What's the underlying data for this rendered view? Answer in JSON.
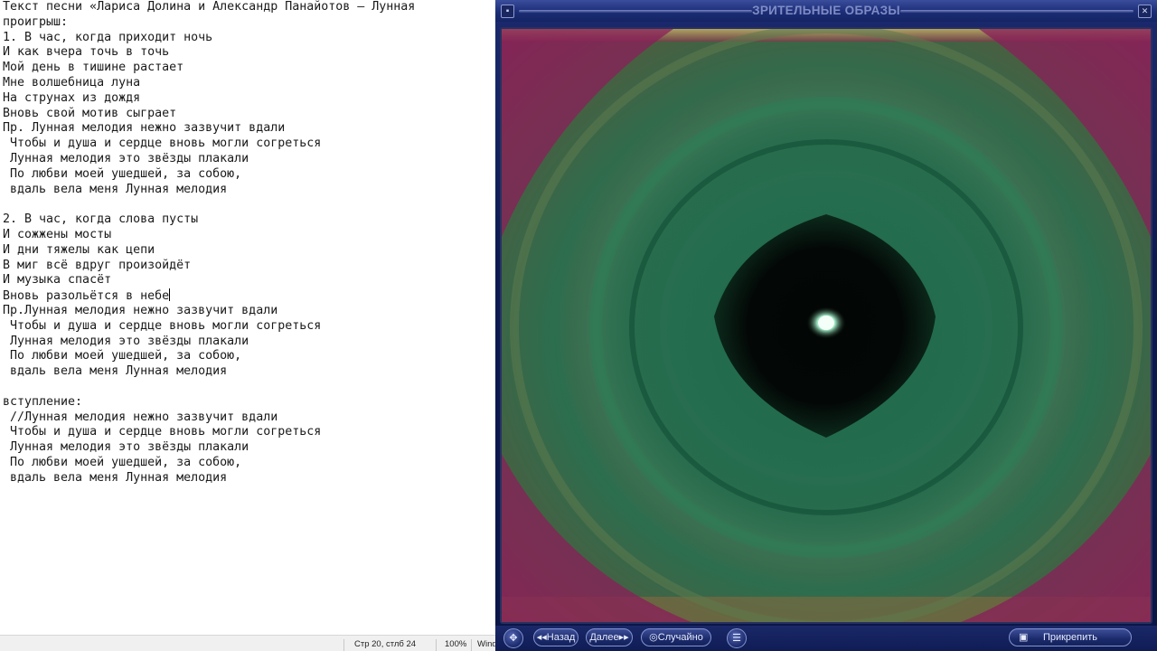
{
  "notepad": {
    "lines": [
      "Текст песни «Лариса Долина и Александр Панайотов – Лунная",
      "проигрыш:",
      "1. В час, когда приходит ночь",
      "И как вчера точь в точь",
      "Мой день в тишине растает",
      "Мне волшебница луна",
      "На струнах из дождя",
      "Вновь свой мотив сыграет",
      "Пр. Лунная мелодия нежно зазвучит вдали",
      " Чтобы и душа и сердце вновь могли согреться",
      " Лунная мелодия это звёзды плакали",
      " По любви моей ушедшей, за собою,",
      " вдаль вела меня Лунная мелодия",
      "",
      "2. В час, когда слова пусты",
      "И сожжены мосты",
      "И дни тяжелы как цепи",
      "В миг всё вдруг произойдёт",
      "И музыка спасёт",
      "Вновь разольётся в небе",
      "Пр.Лунная мелодия нежно зазвучит вдали",
      " Чтобы и душа и сердце вновь могли согреться",
      " Лунная мелодия это звёзды плакали",
      " По любви моей ушедшей, за собою,",
      " вдаль вела меня Лунная мелодия",
      "",
      "вступление:",
      " //Лунная мелодия нежно зазвучит вдали",
      " Чтобы и душа и сердце вновь могли согреться",
      " Лунная мелодия это звёзды плакали",
      " По любви моей ушедшей, за собою,",
      " вдаль вела меня Лунная мелодия"
    ],
    "caret_line_index": 19,
    "status": {
      "position": "Стр 20, стлб 24",
      "zoom": "100%",
      "encoding": "Wind"
    }
  },
  "player": {
    "title": "ЗРИТЕЛЬНЫЕ ОБРАЗЫ",
    "controls": {
      "back_label": "Назад",
      "next_label": "Далее",
      "random_label": "Случайно",
      "pin_label": "Прикрепить"
    },
    "colors": {
      "chrome_dark": "#0d1a52",
      "viz_green": "#1f6b4a",
      "viz_magenta": "#8a1f5a"
    }
  }
}
